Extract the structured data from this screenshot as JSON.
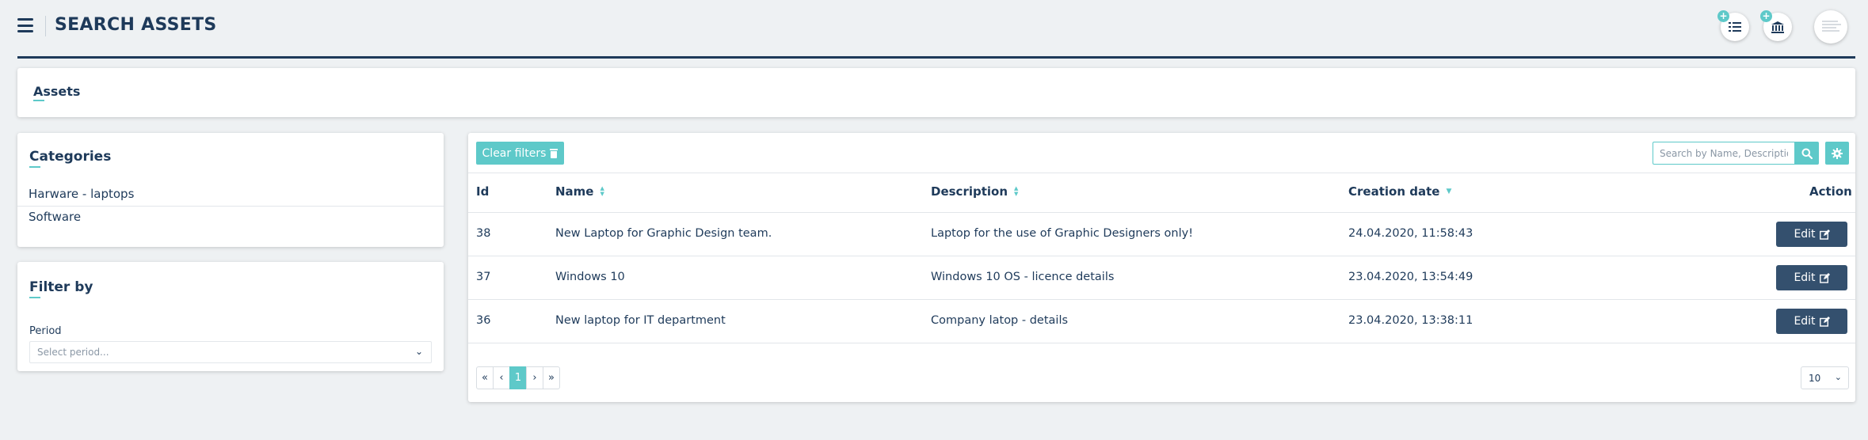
{
  "header": {
    "title": "SEARCH ASSETS",
    "add_badge_1": "+",
    "add_badge_2": "+"
  },
  "breadcrumb": {
    "title": "Assets"
  },
  "categories": {
    "title": "Categories",
    "items": [
      {
        "label": "Harware - laptops"
      },
      {
        "label": "Software"
      }
    ]
  },
  "filter": {
    "title": "Filter by",
    "period_label": "Period",
    "period_placeholder": "Select period..."
  },
  "toolbar": {
    "clear_filters_label": "Clear filters",
    "search_placeholder": "Search by Name, Description"
  },
  "table": {
    "columns": {
      "id": "Id",
      "name": "Name",
      "description": "Description",
      "creation_date": "Creation date",
      "action": "Action"
    },
    "rows": [
      {
        "id": "38",
        "name": "New Laptop for Graphic Design team.",
        "description": "Laptop for the use of Graphic Designers only!",
        "creation_date": "24.04.2020, 11:58:43",
        "action": "Edit"
      },
      {
        "id": "37",
        "name": "Windows 10",
        "description": "Windows 10 OS - licence details",
        "creation_date": "23.04.2020, 13:54:49",
        "action": "Edit"
      },
      {
        "id": "36",
        "name": "New laptop for IT department",
        "description": "Company latop - details",
        "creation_date": "23.04.2020, 13:38:11",
        "action": "Edit"
      }
    ]
  },
  "pagination": {
    "first": "«",
    "prev": "‹",
    "current": "1",
    "next": "›",
    "last": "»",
    "page_size": "10"
  },
  "colors": {
    "primary": "#1e3a5a",
    "accent": "#5ec9c9",
    "edit_button": "#34506e",
    "background": "#eef1f3"
  },
  "icons": {
    "menu": "hamburger-icon",
    "checklist": "checklist-icon",
    "bank": "bank-icon",
    "search": "search-icon",
    "settings": "gear-icon",
    "trash": "trash-icon",
    "edit": "edit-icon"
  }
}
